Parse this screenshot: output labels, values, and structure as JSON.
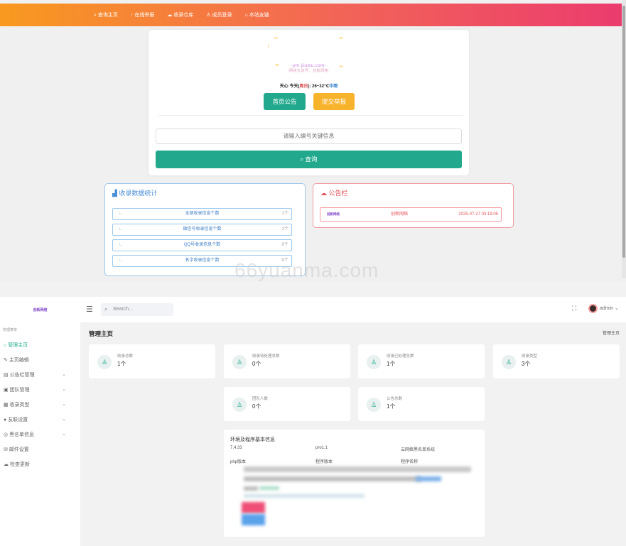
{
  "nav": [
    "查询主页",
    "在线举报",
    "收录仓库",
    "成员登录",
    "本站友链"
  ],
  "nav_icons": [
    "search-icon",
    "arrow-up-icon",
    "cloud-icon",
    "user-icon",
    "home-icon"
  ],
  "site_url": "-ym.jiiuwu.com-",
  "site_sub": "-网络交流号：创新网络-",
  "weather": {
    "place": "天心",
    "today": "今天(",
    "day": "周日",
    "temp": "): 26~32℃",
    "cond": "中雨"
  },
  "home_notice_button": "首页公告",
  "report_button": "提交举报",
  "search_placeholder": "请输入编号关键信息",
  "query_button": "查询",
  "stats": {
    "title": "收录数据统计",
    "rows": [
      {
        "label": "全部收录信息个数",
        "count": "1个"
      },
      {
        "label": "微信号收录信息个数",
        "count": "1个"
      },
      {
        "label": "QQ号收录信息个数",
        "count": "0个"
      },
      {
        "label": "名字收录信息个数",
        "count": "0个"
      }
    ]
  },
  "notice": {
    "title": "公告栏",
    "logo": "创新网络",
    "author": "创新网络",
    "date": "2025-07-27 03:19:05"
  },
  "watermark": "66yuanma.com",
  "admin": {
    "logo": "创新网络",
    "search_placeholder": "Search...",
    "user": "admin",
    "side_label": "管理菜单",
    "menu": [
      {
        "label": "管理主页",
        "expand": false,
        "active": true
      },
      {
        "label": "主页编辑",
        "expand": false,
        "active": false
      },
      {
        "label": "公告栏管理",
        "expand": true,
        "active": false
      },
      {
        "label": "团队管理",
        "expand": true,
        "active": false
      },
      {
        "label": "收录类型",
        "expand": true,
        "active": false
      },
      {
        "label": "友联设置",
        "expand": true,
        "active": false
      },
      {
        "label": "黑名单信息",
        "expand": true,
        "active": false
      },
      {
        "label": "邮件设置",
        "expand": false,
        "active": false
      },
      {
        "label": "检查更新",
        "expand": false,
        "active": false
      }
    ],
    "page_title": "管理主页",
    "breadcrumb": "管理主页",
    "cards": [
      {
        "label": "收录总数",
        "value": "1个"
      },
      {
        "label": "收录待处理总数",
        "value": "0个"
      },
      {
        "label": "收录已处理总数",
        "value": "1个"
      },
      {
        "label": "收录类型",
        "value": "3个"
      },
      {
        "label": "团队人数",
        "value": "0个"
      },
      {
        "label": "公告总数",
        "value": "1个"
      }
    ],
    "env": {
      "title": "环境及程序基本信息",
      "values": [
        "7.4.33",
        "pro1.1",
        "云网络黑名单系统"
      ],
      "labels": [
        "php版本",
        "程序版本",
        "程序名称"
      ]
    }
  }
}
